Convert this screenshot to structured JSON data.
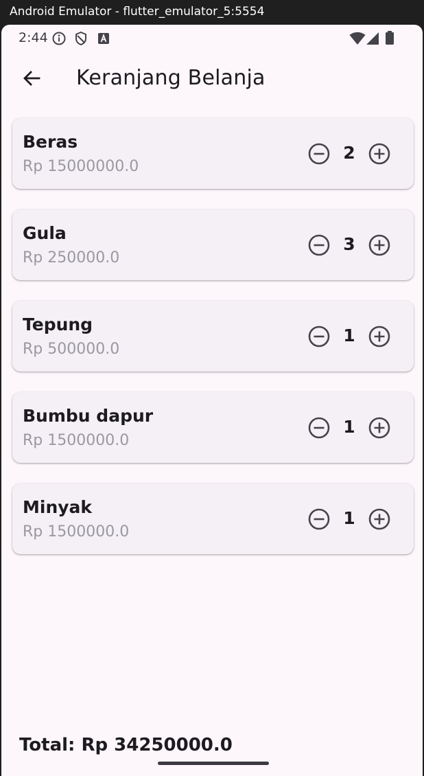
{
  "window": {
    "title": "Android Emulator - flutter_emulator_5:5554"
  },
  "status_bar": {
    "time": "2:44",
    "left_icons": [
      "info-icon",
      "shield-icon",
      "a-badge-icon"
    ],
    "right_icons": [
      "wifi-icon",
      "signal-icon",
      "battery-icon"
    ]
  },
  "app_bar": {
    "title": "Keranjang Belanja",
    "back_icon": "arrow-back-icon"
  },
  "cart": {
    "items": [
      {
        "name": "Beras",
        "price": "Rp 15000000.0",
        "qty": "2"
      },
      {
        "name": "Gula",
        "price": "Rp 250000.0",
        "qty": "3"
      },
      {
        "name": "Tepung",
        "price": "Rp 500000.0",
        "qty": "1"
      },
      {
        "name": "Bumbu dapur",
        "price": "Rp 1500000.0",
        "qty": "1"
      },
      {
        "name": "Minyak",
        "price": "Rp 1500000.0",
        "qty": "1"
      }
    ]
  },
  "total": {
    "label": "Total: Rp 34250000.0"
  },
  "colors": {
    "background": "#fdf7fb",
    "card": "#f4f0f6",
    "text": "#1d1b20",
    "muted": "#9a98a0"
  }
}
